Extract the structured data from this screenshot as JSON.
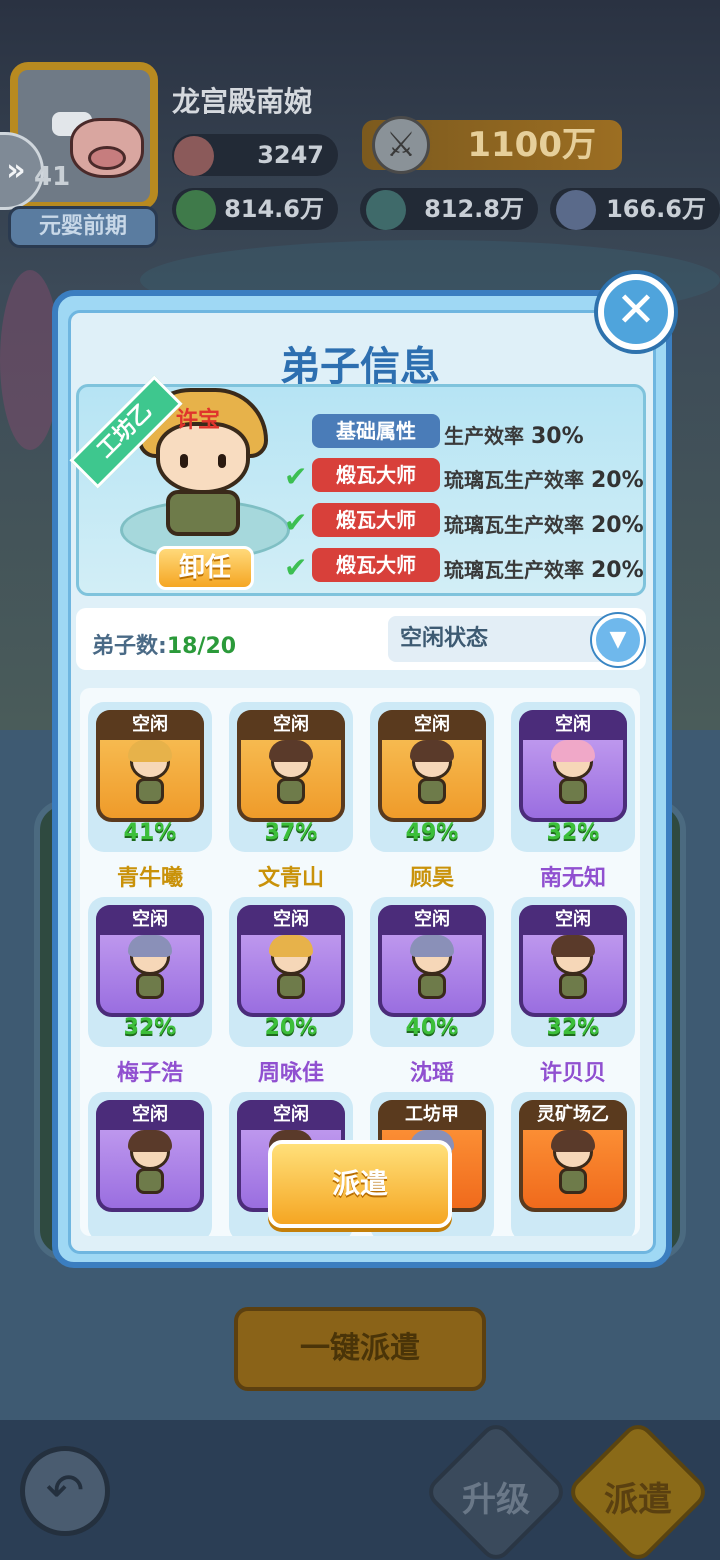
{
  "player": {
    "name": "龙宫殿南婉",
    "level": "41",
    "rank": "元婴前期"
  },
  "resources": {
    "peach": "3247",
    "power": "1100万",
    "herb": "814.6万",
    "ore": "812.8万",
    "rainbow": "166.6万"
  },
  "modal": {
    "title": "弟子信息",
    "close_label": "✕",
    "disciple": {
      "workshop": "工坊乙",
      "name": "许宝",
      "unequip": "卸任",
      "attributes": [
        {
          "tag": "基础属性",
          "text": "生产效率",
          "value": "30%",
          "active": false
        },
        {
          "tag": "煅瓦大师",
          "text": "琉璃瓦生产效率",
          "value": "20%",
          "active": true
        },
        {
          "tag": "煅瓦大师",
          "text": "琉璃瓦生产效率",
          "value": "20%",
          "active": true
        },
        {
          "tag": "煅瓦大师",
          "text": "琉璃瓦生产效率",
          "value": "20%",
          "active": true
        }
      ]
    },
    "filter": {
      "count_label": "弟子数:",
      "count_value": "18/20",
      "status_selected": "空闲状态"
    },
    "disciples": [
      {
        "status": "空闲",
        "pct": "41%",
        "name": "青牛曦"
      },
      {
        "status": "空闲",
        "pct": "37%",
        "name": "文青山"
      },
      {
        "status": "空闲",
        "pct": "49%",
        "name": "顾昊"
      },
      {
        "status": "空闲",
        "pct": "32%",
        "name": "南无知"
      },
      {
        "status": "空闲",
        "pct": "32%",
        "name": "梅子浩"
      },
      {
        "status": "空闲",
        "pct": "20%",
        "name": "周咏佳"
      },
      {
        "status": "空闲",
        "pct": "40%",
        "name": "沈瑶"
      },
      {
        "status": "空闲",
        "pct": "32%",
        "name": "许贝贝"
      },
      {
        "status": "空闲",
        "pct": "",
        "name": ""
      },
      {
        "status": "空闲",
        "pct": "",
        "name": ""
      },
      {
        "status": "工坊甲",
        "pct": "",
        "name": ""
      },
      {
        "status": "灵矿场乙",
        "pct": "",
        "name": ""
      }
    ],
    "dispatch": "派遣"
  },
  "bottom": {
    "bulk_dispatch": "一键派遣",
    "upgrade": "升级",
    "dispatch": "派遣"
  },
  "colors": {
    "modal_border": "#3b7ec0",
    "title": "#2d6fb0",
    "percent_green": "#3cbf3a",
    "name_gold": "#c9920a",
    "name_purple": "#9050d0",
    "button_gold": "#f5a623"
  }
}
